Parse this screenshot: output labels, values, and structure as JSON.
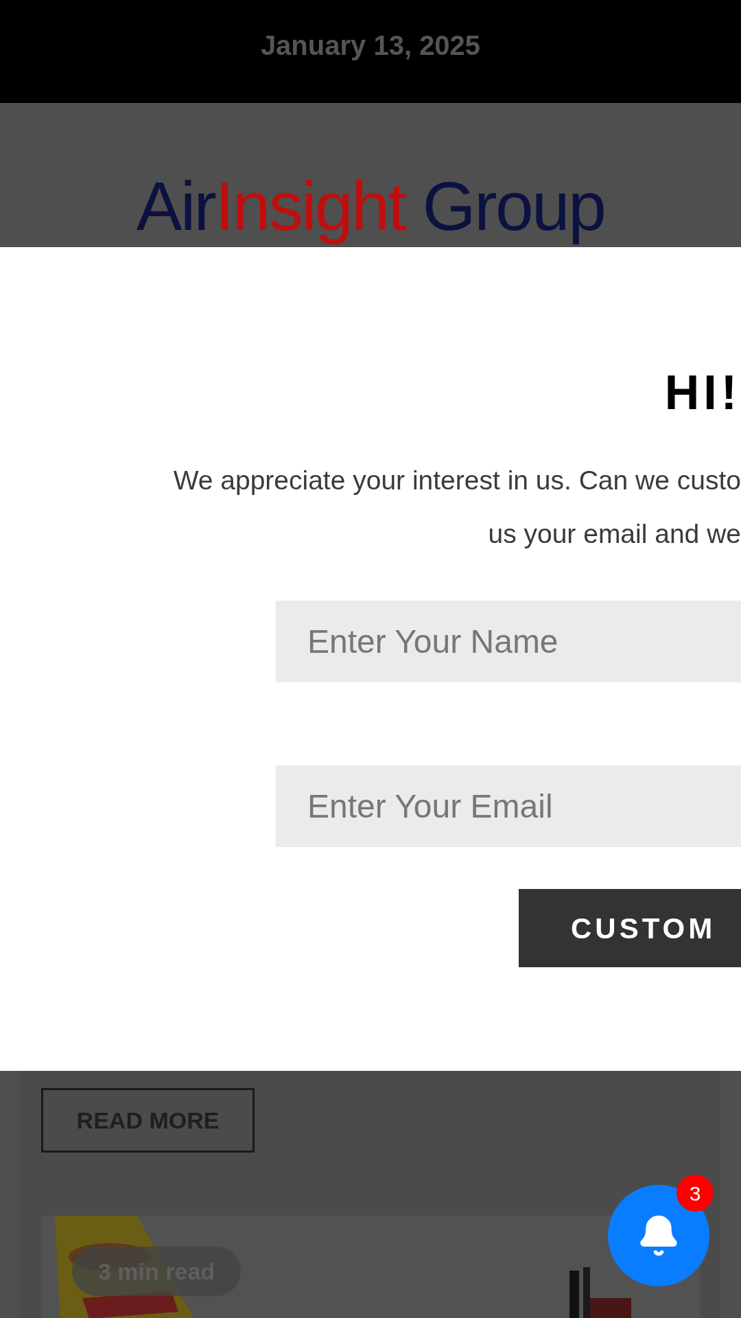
{
  "header": {
    "date": "January 13, 2025"
  },
  "logo": {
    "parts": [
      {
        "text": "Air",
        "color": "#0b1240"
      },
      {
        "text": "Insight",
        "color": "#c00e0e"
      },
      {
        "text": " Group",
        "color": "#0b1240"
      }
    ]
  },
  "popup": {
    "title": "HI!",
    "message_lines": [
      "We appreciate your interest in us. Can we custo",
      "us your email and we"
    ],
    "name_field": {
      "placeholder": "Enter Your Name"
    },
    "email_field": {
      "placeholder": "Enter Your Email"
    },
    "submit_button": "CUSTOM"
  },
  "article": {
    "read_more": "READ MORE",
    "read_time": "3 min read"
  },
  "notifications": {
    "count": "3"
  }
}
